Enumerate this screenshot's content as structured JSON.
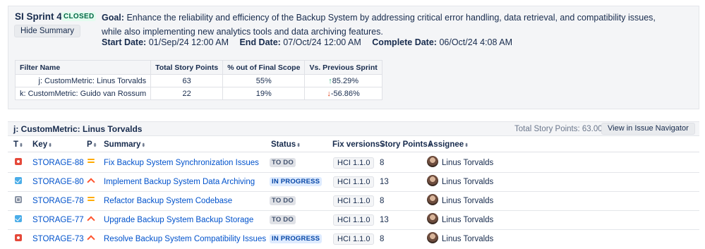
{
  "sprint": {
    "title": "SI Sprint 46",
    "status_badge": "CLOSED",
    "hide_summary_label": "Hide Summary",
    "goal_label": "Goal:",
    "goal_text": "Enhance the reliability and efficiency of the Backup System by addressing critical error handling, data retrieval, and compatibility issues, while also implementing new analytics tools and data archiving features.",
    "start_label": "Start Date:",
    "start_value": "01/Sep/24 12:00 AM",
    "end_label": "End Date:",
    "end_value": "07/Oct/24 12:00 AM",
    "complete_label": "Complete Date:",
    "complete_value": "06/Oct/24 4:08 AM"
  },
  "filters_table": {
    "headers": [
      "Filter Name",
      "Total Story Points",
      "% out of Final Scope",
      "Vs. Previous Sprint"
    ],
    "rows": [
      {
        "name": "j: CustomMetric: Linus Torvalds",
        "points": "63",
        "pct": "55%",
        "trend": "up",
        "trend_glyph": "↑",
        "vs": "85.29%"
      },
      {
        "name": "k: CustomMetric: Guido van Rossum",
        "points": "22",
        "pct": "19%",
        "trend": "down",
        "trend_glyph": "↓",
        "vs": "-56.86%"
      }
    ]
  },
  "issues_section": {
    "title": "j: CustomMetric: Linus Torvalds",
    "total_points": "Total Story Points: 63.00",
    "navigator_label": "View in Issue Navigator",
    "columns": [
      "T",
      "Key",
      "P",
      "Summary",
      "Status",
      "Fix versions",
      "Story Points",
      "Assignee"
    ],
    "sort_glyph": "⬍"
  },
  "issues": [
    {
      "type_icon": "bug-icon",
      "key": "STORAGE-88",
      "priority_icon": "priority-medium-icon",
      "summary": "Fix Backup System Synchronization Issues",
      "status": "TO DO",
      "status_kind": "todo",
      "fix_version": "HCI 1.1.0",
      "points": "8",
      "assignee": "Linus Torvalds"
    },
    {
      "type_icon": "task-icon",
      "key": "STORAGE-80",
      "priority_icon": "priority-high-icon",
      "summary": "Implement Backup System Data Archiving",
      "status": "IN PROGRESS",
      "status_kind": "prog",
      "fix_version": "HCI 1.1.0",
      "points": "13",
      "assignee": "Linus Torvalds"
    },
    {
      "type_icon": "subtask-icon",
      "key": "STORAGE-78",
      "priority_icon": "priority-medium-icon",
      "summary": "Refactor Backup System Codebase",
      "status": "TO DO",
      "status_kind": "todo",
      "fix_version": "HCI 1.1.0",
      "points": "8",
      "assignee": "Linus Torvalds"
    },
    {
      "type_icon": "task-icon",
      "key": "STORAGE-77",
      "priority_icon": "priority-high-icon",
      "summary": "Upgrade Backup System Backup Storage",
      "status": "TO DO",
      "status_kind": "todo",
      "fix_version": "HCI 1.1.0",
      "points": "13",
      "assignee": "Linus Torvalds"
    },
    {
      "type_icon": "bug-icon",
      "key": "STORAGE-73",
      "priority_icon": "priority-high-icon",
      "summary": "Resolve Backup System Compatibility Issues",
      "status": "IN PROGRESS",
      "status_kind": "prog",
      "fix_version": "HCI 1.1.0",
      "points": "8",
      "assignee": "Linus Torvalds"
    }
  ]
}
